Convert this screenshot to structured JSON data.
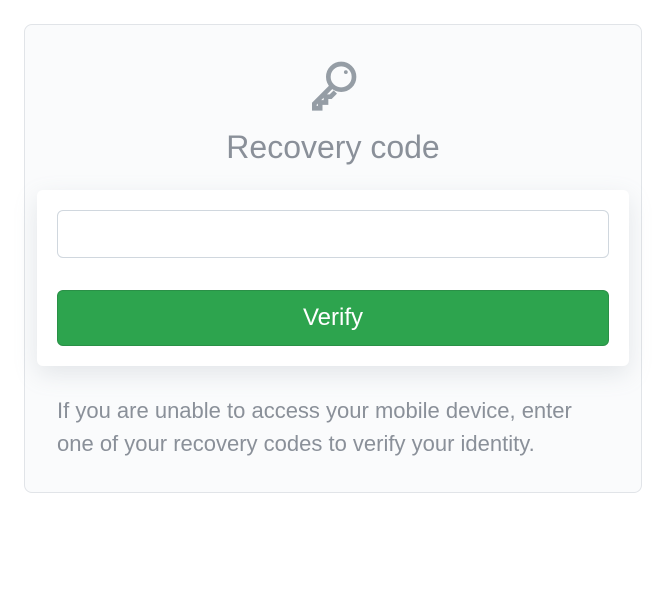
{
  "recovery": {
    "title": "Recovery code",
    "input_value": "",
    "input_placeholder": "",
    "verify_label": "Verify",
    "help_text": "If you are unable to access your mobile device, enter one of your recovery codes to verify your identity."
  }
}
